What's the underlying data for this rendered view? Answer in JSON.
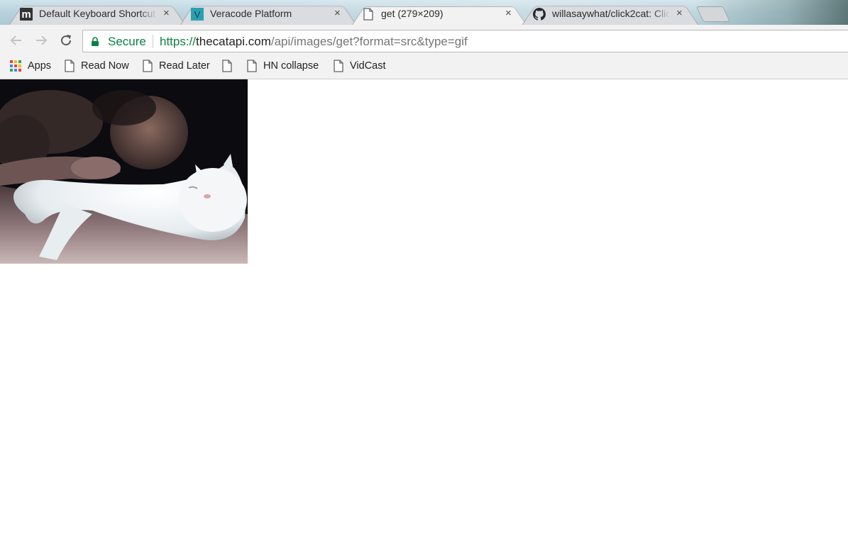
{
  "tabs": [
    {
      "title": "Default Keyboard Shortcuts",
      "favicon": "m-logo-icon",
      "close": "×",
      "active": false
    },
    {
      "title": "Veracode Platform",
      "favicon": "veracode-v-icon",
      "close": "×",
      "active": false
    },
    {
      "title": "get (279×209)",
      "favicon": "page-icon",
      "close": "×",
      "active": true
    },
    {
      "title": "willasaywhat/click2cat: Click",
      "favicon": "github-icon",
      "close": "×",
      "active": false
    }
  ],
  "favicon_letters": {
    "tab1": "m",
    "tab2": "V"
  },
  "toolbar": {
    "back_icon": "arrow-left-icon",
    "forward_icon": "arrow-right-icon",
    "reload_icon": "reload-icon",
    "security_label": "Secure",
    "url_scheme": "https://",
    "url_host": "thecatapi.com",
    "url_path": "/api/images/get?format=src&type=gif"
  },
  "bookmarks": [
    {
      "label": "Apps",
      "icon": "apps-grid-icon"
    },
    {
      "label": "Read Now",
      "icon": "page-icon"
    },
    {
      "label": "Read Later",
      "icon": "page-icon"
    },
    {
      "label": "",
      "icon": "page-icon"
    },
    {
      "label": "HN collapse",
      "icon": "page-icon"
    },
    {
      "label": "VidCast",
      "icon": "page-icon"
    }
  ],
  "colors": {
    "secure_green": "#0b8043",
    "tab_active": "#f2f2f2",
    "tab_inactive": "#dadcdf",
    "toolbar_bg": "#f2f2f2",
    "veracode_teal": "#2aa1b3"
  }
}
